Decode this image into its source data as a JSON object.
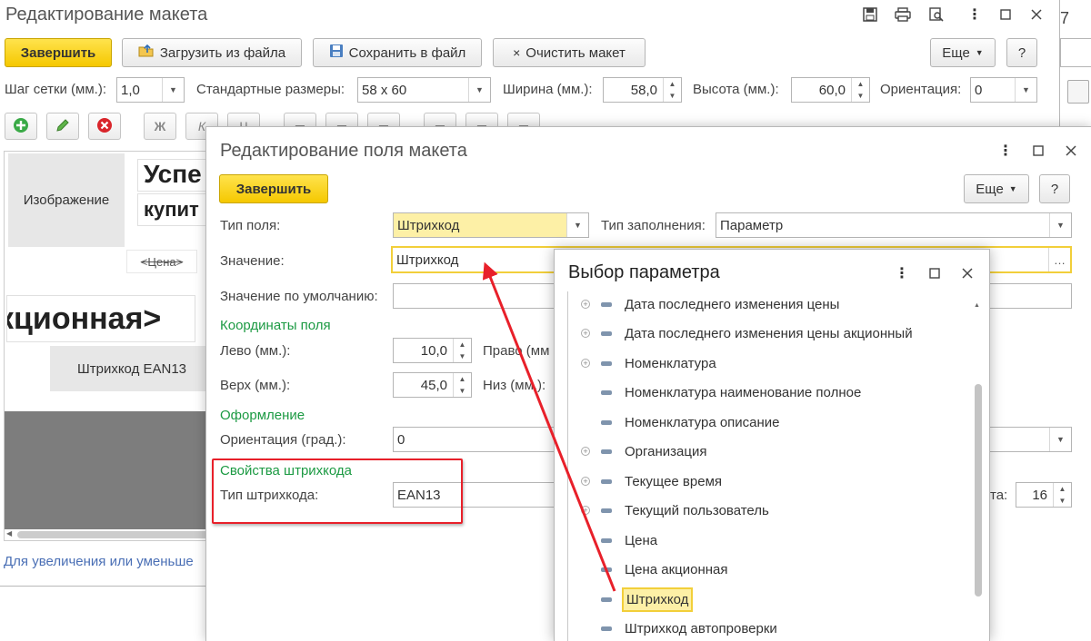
{
  "main_window": {
    "title": "Редактирование макета",
    "finish_button": "Завершить",
    "load_button": "Загрузить из файла",
    "save_button": "Сохранить в файл",
    "clear_button": "Очистить макет",
    "more_button": "Еще",
    "help_button": "?",
    "grid_step_label": "Шаг сетки (мм.):",
    "grid_step_value": "1,0",
    "std_sizes_label": "Стандартные размеры:",
    "std_sizes_value": "58 x 60",
    "width_label": "Ширина (мм.):",
    "width_value": "58,0",
    "height_label": "Высота (мм.):",
    "height_value": "60,0",
    "orientation_label": "Ориентация:",
    "orientation_value": "0",
    "format_bold": "Ж",
    "format_italic": "К",
    "format_underline": "Ч",
    "canvas": {
      "image_cell": "Изображение",
      "text1": "Успе",
      "text2": "купит",
      "price_tag": "<Цена>",
      "promo_text": "кционная>",
      "barcode_cell": "Штрихкод EAN13"
    },
    "hint_link": "Для увеличения или уменьше",
    "right_edge_digit": "7"
  },
  "field_dialog": {
    "title": "Редактирование поля макета",
    "finish_button": "Завершить",
    "more_button": "Еще",
    "help_button": "?",
    "field_type_label": "Тип поля:",
    "field_type_value": "Штрихкод",
    "fill_type_label": "Тип заполнения:",
    "fill_type_value": "Параметр",
    "value_label": "Значение:",
    "value_value": "Штрихкод",
    "default_label": "Значение по умолчанию:",
    "coords_section": "Координаты поля",
    "left_label": "Лево (мм.):",
    "left_value": "10,0",
    "right_label": "Право (мм",
    "top_label": "Верх (мм.):",
    "top_value": "45,0",
    "bottom_label": "Низ (мм.):",
    "design_section": "Оформление",
    "orientation_label": "Ориентация (град.):",
    "orientation_value": "0",
    "barcode_section": "Свойства штрихкода",
    "barcode_type_label": "Тип штрихкода:",
    "barcode_type_value": "EAN13",
    "right_partial_label": "та:",
    "right_partial_value": "16"
  },
  "param_dialog": {
    "title": "Выбор параметра",
    "items": [
      {
        "label": "Дата последнего изменения цены",
        "expandable": true
      },
      {
        "label": "Дата последнего изменения цены акционный",
        "expandable": true
      },
      {
        "label": "Номенклатура",
        "expandable": true
      },
      {
        "label": "Номенклатура наименование полное",
        "expandable": false
      },
      {
        "label": "Номенклатура описание",
        "expandable": false
      },
      {
        "label": "Организация",
        "expandable": true
      },
      {
        "label": "Текущее время",
        "expandable": true
      },
      {
        "label": "Текущий пользователь",
        "expandable": true
      },
      {
        "label": "Цена",
        "expandable": false
      },
      {
        "label": "Цена акционная",
        "expandable": false
      },
      {
        "label": "Штрихкод",
        "expandable": false,
        "selected": true
      },
      {
        "label": "Штрихкод автопроверки",
        "expandable": false
      }
    ]
  },
  "colors": {
    "accent_yellow": "#f5c800",
    "section_green": "#1c9a43",
    "highlight_red": "#e8202a",
    "link_blue": "#4a6fb5"
  }
}
